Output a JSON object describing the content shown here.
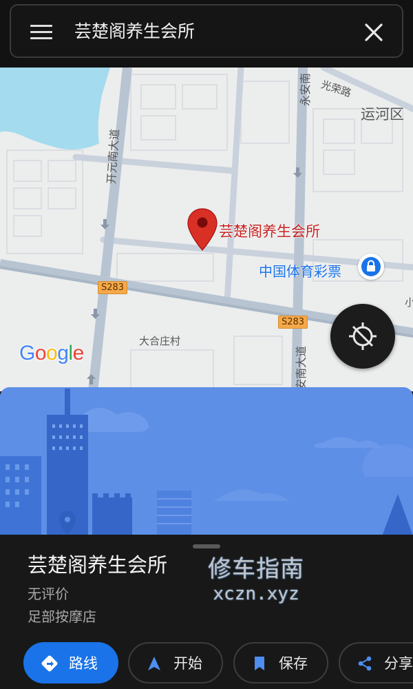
{
  "search": {
    "query": "芸楚阁养生会所",
    "menu_icon": "menu-icon",
    "close_icon": "close-icon"
  },
  "map": {
    "pin_label": "芸楚阁养生会所",
    "poi_label": "中国体育彩票",
    "road_labels": {
      "kaiyuan": "开元南大道",
      "yongan": "永安南",
      "yongan_south": "安南大道",
      "guangrong": "光荣路",
      "district": "运河区",
      "village": "大合庄村",
      "edge": "小"
    },
    "road_badges": [
      "S283",
      "S283"
    ],
    "google_logo": [
      "G",
      "o",
      "o",
      "g",
      "l",
      "e"
    ],
    "colors": {
      "pin": "#d93025",
      "water": "#a4dbef",
      "road": "#b8c4d2",
      "poi": "#1a73e8"
    }
  },
  "place": {
    "title": "芸楚阁养生会所",
    "rating": "无评价",
    "category": "足部按摩店"
  },
  "watermark": {
    "cn": "修车指南",
    "en": "xczn.xyz"
  },
  "actions": [
    {
      "label": "路线",
      "icon": "directions-icon"
    },
    {
      "label": "开始",
      "icon": "navigation-arrow-icon"
    },
    {
      "label": "保存",
      "icon": "bookmark-icon"
    },
    {
      "label": "分享",
      "icon": "share-icon"
    }
  ],
  "colors": {
    "accent": "#1a73e8",
    "hero": "#5e8fe6",
    "sheet": "#181818"
  }
}
